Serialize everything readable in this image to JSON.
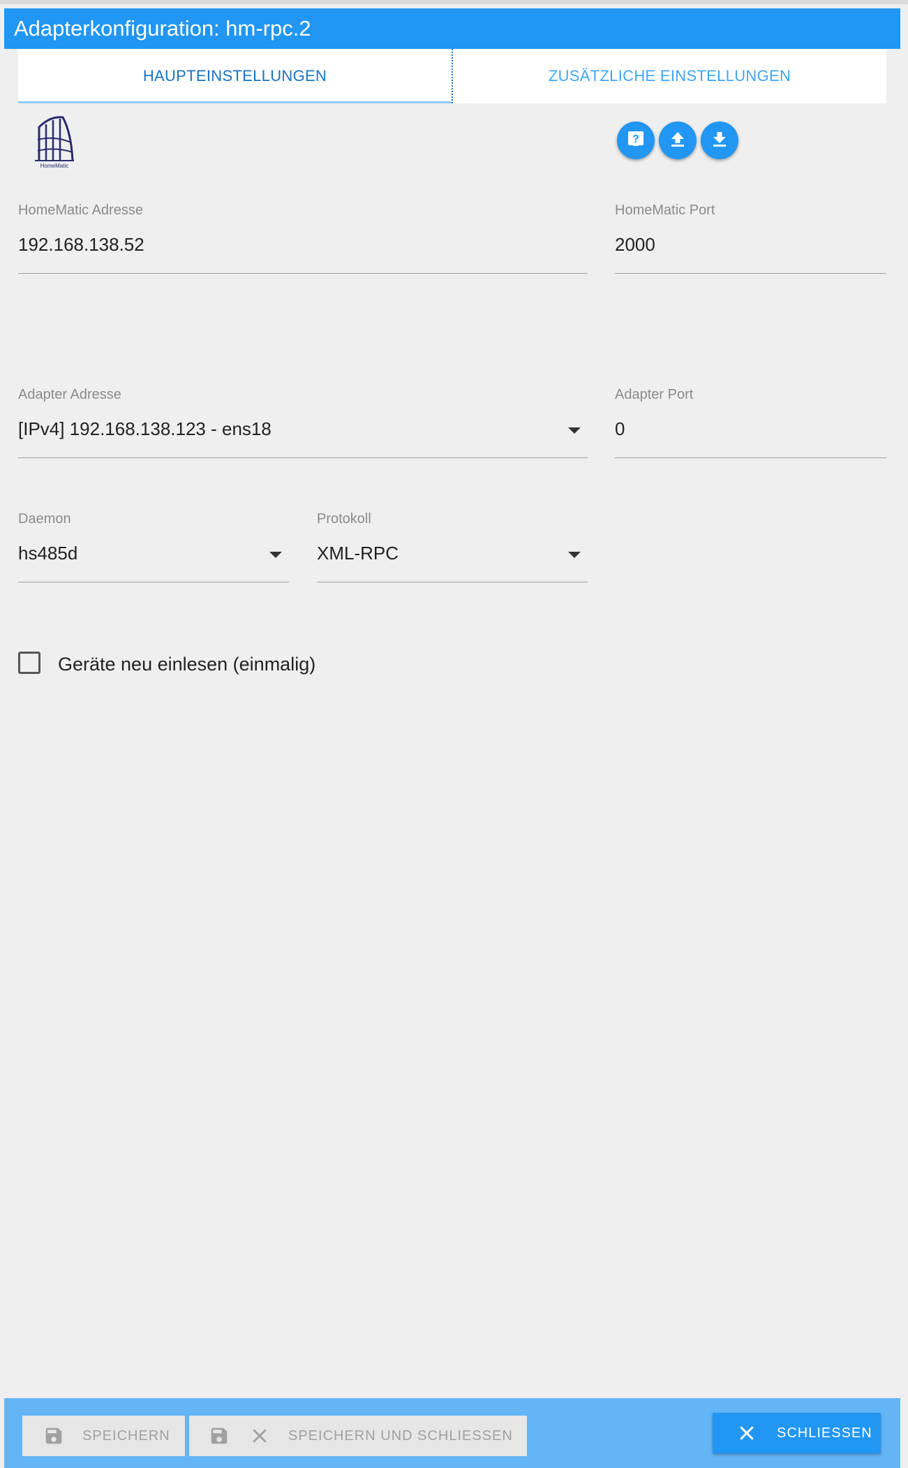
{
  "window": {
    "title": "Adapterkonfiguration: hm-rpc.2"
  },
  "tabs": [
    {
      "label": "HAUPTEINSTELLUNGEN",
      "active": true
    },
    {
      "label": "ZUSÄTZLICHE EINSTELLUNGEN",
      "active": false
    }
  ],
  "logo": {
    "text": "HomeMatic"
  },
  "toolbar": {
    "icons": [
      "help-icon",
      "upload-icon",
      "download-icon"
    ]
  },
  "fields": {
    "homematic_address": {
      "label": "HomeMatic Adresse",
      "value": "192.168.138.52"
    },
    "homematic_port": {
      "label": "HomeMatic Port",
      "value": "2000"
    },
    "adapter_address": {
      "label": "Adapter Adresse",
      "value": "[IPv4] 192.168.138.123 - ens18"
    },
    "adapter_port": {
      "label": "Adapter Port",
      "value": "0"
    },
    "daemon": {
      "label": "Daemon",
      "value": "hs485d"
    },
    "protocol": {
      "label": "Protokoll",
      "value": "XML-RPC"
    }
  },
  "checkbox": {
    "label": "Geräte neu einlesen (einmalig)",
    "checked": false
  },
  "footer": {
    "save_label": "SPEICHERN",
    "save_close_label": "SPEICHERN UND SCHLIESSEN",
    "close_label": "SCHLIESSEN"
  },
  "colors": {
    "accent": "#2196f3",
    "footer": "#64b5f6",
    "background": "#efefef"
  }
}
